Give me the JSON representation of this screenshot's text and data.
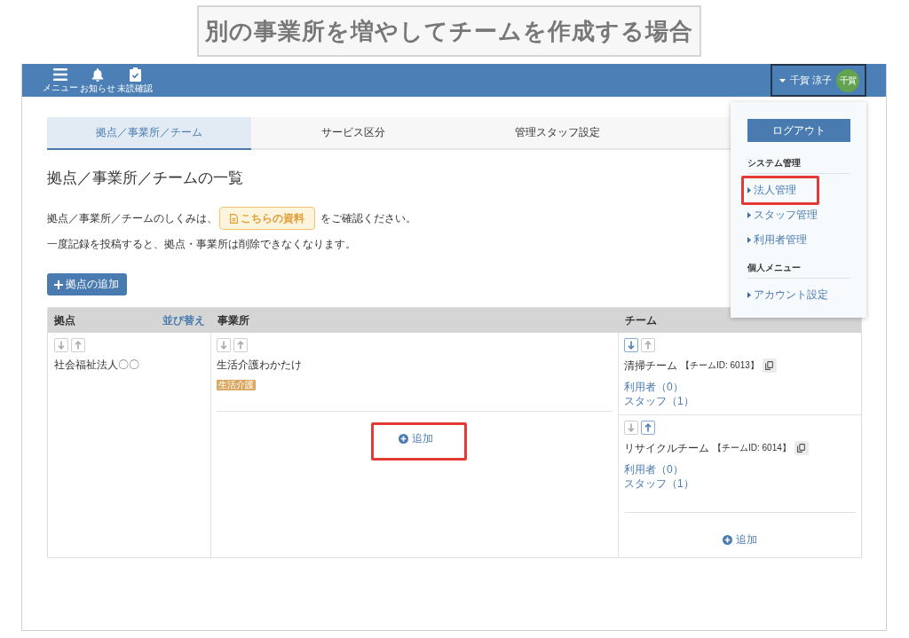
{
  "banner": {
    "title": "別の事業所を増やしてチームを作成する場合"
  },
  "top_bar": {
    "icons": [
      {
        "kind": "menu",
        "label": "メニュー"
      },
      {
        "kind": "bell",
        "label": "お知らせ"
      },
      {
        "kind": "clipboard",
        "label": "未読確認"
      }
    ],
    "user": {
      "name": "千賀 涼子",
      "avatar": "千賀",
      "expanded": true
    }
  },
  "user_menu": {
    "logout": "ログアウト",
    "sections": [
      {
        "heading": "システム管理",
        "items": [
          {
            "label": "法人管理",
            "highlighted": true
          },
          {
            "label": "スタッフ管理",
            "highlighted": false
          },
          {
            "label": "利用者管理",
            "highlighted": false
          }
        ]
      },
      {
        "heading": "個人メニュー",
        "items": [
          {
            "label": "アカウント設定",
            "highlighted": false
          }
        ]
      }
    ]
  },
  "tabs": [
    {
      "label": "拠点／事業所／チーム",
      "selected": true
    },
    {
      "label": "サービス区分",
      "selected": false
    },
    {
      "label": "管理スタッフ設定",
      "selected": false
    }
  ],
  "page_title": "拠点／事業所／チームの一覧",
  "guide": {
    "before": "拠点／事業所／チームのしくみは、",
    "link": "こちらの資料",
    "after": "をご確認ください。"
  },
  "warning": "一度記録を投稿すると、拠点・事業所は削除できなくなります。",
  "add_base_button": "拠点の追加",
  "table": {
    "columns": [
      {
        "label": "拠点",
        "action": "並び替え"
      },
      {
        "label": "事業所"
      },
      {
        "label": "チーム"
      }
    ],
    "bases": [
      {
        "name": "社会福祉法人〇〇",
        "arrows": [
          {
            "kind": "down",
            "disabled": true
          },
          {
            "kind": "up",
            "disabled": true
          }
        ]
      }
    ],
    "offices": [
      {
        "name": "生活介護わかたけ",
        "tag": "生活介護",
        "arrows": [
          {
            "kind": "down",
            "disabled": true
          },
          {
            "kind": "up",
            "disabled": true
          }
        ]
      }
    ],
    "office_add": {
      "label": "追加",
      "highlighted": true
    },
    "teams": [
      {
        "name": "清掃チーム",
        "team_id": "【チームID: 6013】",
        "links": [
          "利用者（0）",
          "スタッフ（1）"
        ],
        "arrows": [
          {
            "kind": "down",
            "disabled": false
          },
          {
            "kind": "up",
            "disabled": true
          }
        ]
      },
      {
        "name": "リサイクルチーム",
        "team_id": "【チームID: 6014】",
        "links": [
          "利用者（0）",
          "スタッフ（1）"
        ],
        "arrows": [
          {
            "kind": "down",
            "disabled": true
          },
          {
            "kind": "up",
            "disabled": false
          }
        ]
      }
    ],
    "team_add": {
      "label": "追加",
      "highlighted": false
    }
  }
}
